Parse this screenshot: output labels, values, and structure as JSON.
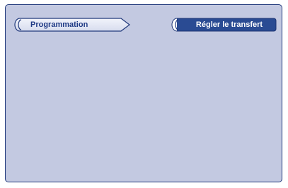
{
  "toolbar": {
    "programming_label": "Programmation",
    "transfer_label": "Régler le transfert"
  },
  "colors": {
    "screen_background": "#c3c9e1",
    "border": "#223a7c",
    "programming_button_fill": "#e3e7f4",
    "transfer_button_fill": "#2a4b93"
  }
}
